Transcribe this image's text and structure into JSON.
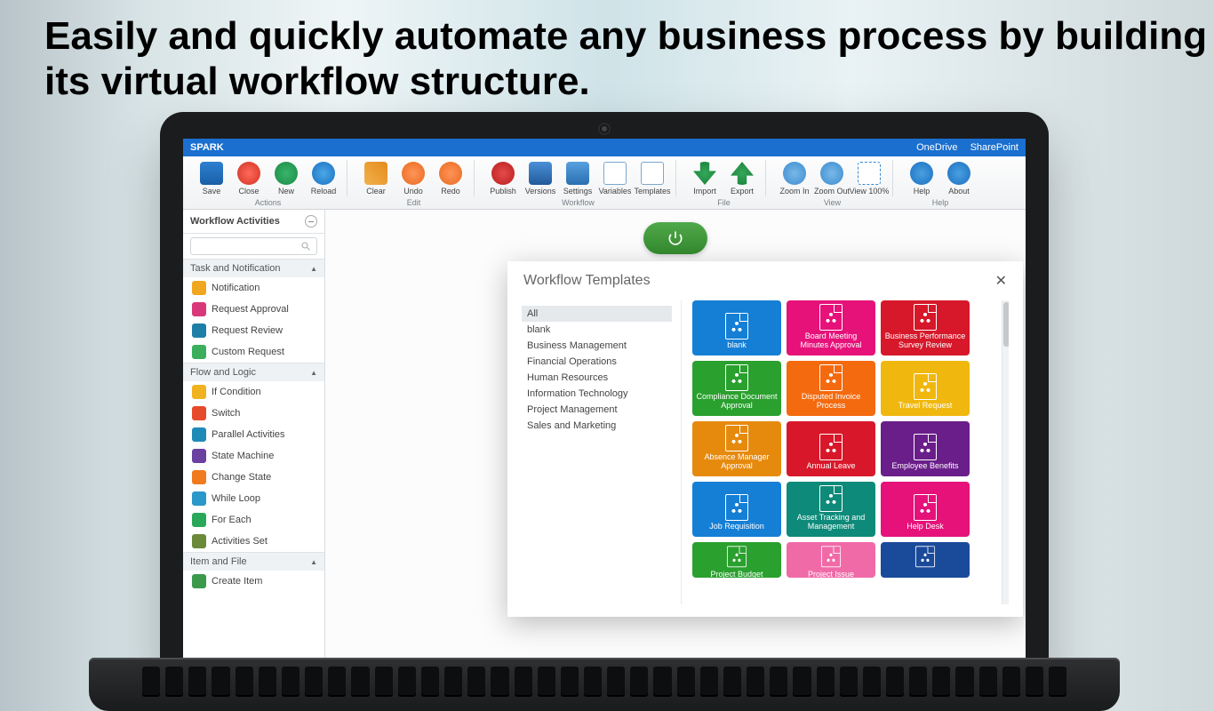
{
  "headline": "Easily and quickly automate any business process by building its virtual workflow structure.",
  "app": {
    "name": "SPARK",
    "quicklinks": [
      "OneDrive",
      "SharePoint"
    ]
  },
  "ribbon": {
    "groups": [
      {
        "label": "Actions",
        "buttons": [
          {
            "id": "save",
            "label": "Save",
            "ic": "ic-save"
          },
          {
            "id": "close",
            "label": "Close",
            "ic": "ic-close"
          },
          {
            "id": "new",
            "label": "New",
            "ic": "ic-new"
          },
          {
            "id": "reload",
            "label": "Reload",
            "ic": "ic-reload"
          }
        ]
      },
      {
        "label": "Edit",
        "buttons": [
          {
            "id": "clear",
            "label": "Clear",
            "ic": "ic-clear"
          },
          {
            "id": "undo",
            "label": "Undo",
            "ic": "ic-undo"
          },
          {
            "id": "redo",
            "label": "Redo",
            "ic": "ic-redo"
          }
        ]
      },
      {
        "label": "Workflow",
        "buttons": [
          {
            "id": "publish",
            "label": "Publish",
            "ic": "ic-publish"
          },
          {
            "id": "versions",
            "label": "Versions",
            "ic": "ic-versions"
          },
          {
            "id": "settings",
            "label": "Settings",
            "ic": "ic-settings"
          },
          {
            "id": "variables",
            "label": "Variables",
            "ic": "ic-vars"
          },
          {
            "id": "templates",
            "label": "Templates",
            "ic": "ic-tmpl"
          }
        ]
      },
      {
        "label": "File",
        "buttons": [
          {
            "id": "import",
            "label": "Import",
            "ic": "ic-import"
          },
          {
            "id": "export",
            "label": "Export",
            "ic": "ic-export"
          }
        ]
      },
      {
        "label": "View",
        "buttons": [
          {
            "id": "zoomin",
            "label": "Zoom In",
            "ic": "ic-zin"
          },
          {
            "id": "zoomout",
            "label": "Zoom Out",
            "ic": "ic-zout"
          },
          {
            "id": "zoom100",
            "label": "View 100%",
            "ic": "ic-z100"
          }
        ]
      },
      {
        "label": "Help",
        "buttons": [
          {
            "id": "help",
            "label": "Help",
            "ic": "ic-help"
          },
          {
            "id": "about",
            "label": "About",
            "ic": "ic-about"
          }
        ]
      }
    ]
  },
  "sidebar": {
    "title": "Workflow Activities",
    "search_placeholder": "",
    "sections": [
      {
        "name": "Task and Notification",
        "open": true,
        "items": [
          {
            "label": "Notification",
            "color": "#f0a61e"
          },
          {
            "label": "Request Approval",
            "color": "#d8387a"
          },
          {
            "label": "Request Review",
            "color": "#1e7fa6"
          },
          {
            "label": "Custom Request",
            "color": "#3aae5a"
          }
        ]
      },
      {
        "name": "Flow and Logic",
        "open": true,
        "items": [
          {
            "label": "If Condition",
            "color": "#f0b21e"
          },
          {
            "label": "Switch",
            "color": "#e64a2a"
          },
          {
            "label": "Parallel Activities",
            "color": "#1e8ab6"
          },
          {
            "label": "State Machine",
            "color": "#6a40a0"
          },
          {
            "label": "Change State",
            "color": "#f07a1e"
          },
          {
            "label": "While Loop",
            "color": "#2a98c8"
          },
          {
            "label": "For Each",
            "color": "#2aa85a"
          },
          {
            "label": "Activities Set",
            "color": "#6a8a3a"
          }
        ]
      },
      {
        "name": "Item and File",
        "open": true,
        "items": [
          {
            "label": "Create Item",
            "color": "#3a9a4a"
          }
        ]
      }
    ]
  },
  "modal": {
    "title": "Workflow Templates",
    "categories": [
      "All",
      "blank",
      "Business Management",
      "Financial Operations",
      "Human Resources",
      "Information Technology",
      "Project Management",
      "Sales and Marketing"
    ],
    "selected_category": "All",
    "tiles": [
      {
        "label": "blank",
        "color": "#157fd6"
      },
      {
        "label": "Board Meeting Minutes Approval",
        "color": "#e6127a"
      },
      {
        "label": "Business Performance Survey Review",
        "color": "#d6182a"
      },
      {
        "label": "Compliance Document Approval",
        "color": "#2aa02e"
      },
      {
        "label": "Disputed Invoice Process",
        "color": "#f46a0e"
      },
      {
        "label": "Travel Request",
        "color": "#f0b80e"
      },
      {
        "label": "Absence Manager Approval",
        "color": "#e68a0e"
      },
      {
        "label": "Annual Leave",
        "color": "#d8182a"
      },
      {
        "label": "Employee Benefits",
        "color": "#6a1e8a"
      },
      {
        "label": "Job Requisition",
        "color": "#157fd6"
      },
      {
        "label": "Asset Tracking and Management",
        "color": "#0e8a7a"
      },
      {
        "label": "Help Desk",
        "color": "#e6127a"
      },
      {
        "label": "Project Budget",
        "color": "#2aa02e",
        "cut": true
      },
      {
        "label": "Project Issue",
        "color": "#f06aa8",
        "cut": true
      },
      {
        "label": "",
        "color": "#1a4a9a",
        "cut": true
      }
    ]
  }
}
